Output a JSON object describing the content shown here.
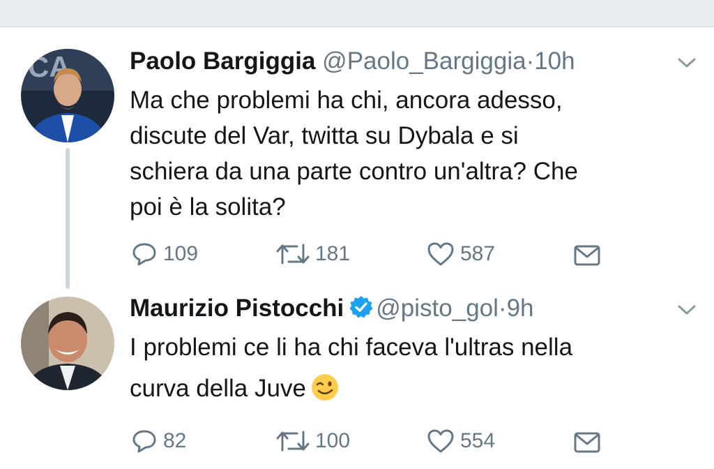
{
  "tweets": [
    {
      "name": "Paolo Bargiggia",
      "handle": "@Paolo_Bargiggia",
      "separator": "·",
      "time": "10h",
      "verified": false,
      "text_lines": [
        "Ma che problemi ha chi, ancora adesso,",
        "discute del Var, twitta su Dybala e si",
        "schiera da una parte contro un'altra? Che",
        "poi è la solita?"
      ],
      "replies": "109",
      "retweets": "181",
      "likes": "587"
    },
    {
      "name": "Maurizio Pistocchi",
      "handle": "@pisto_gol",
      "separator": "·",
      "time": "9h",
      "verified": true,
      "text_lines": [
        "I problemi ce li ha chi faceva l'ultras nella",
        "curva della Juve"
      ],
      "emoji": "winking-face",
      "replies": "82",
      "retweets": "100",
      "likes": "554"
    }
  ],
  "icons": {
    "reply": "reply-icon",
    "retweet": "retweet-icon",
    "like": "heart-icon",
    "message": "envelope-icon",
    "menu": "chevron-down-icon",
    "verified": "verified-badge-icon"
  },
  "colors": {
    "text": "#14171a",
    "secondary": "#657786",
    "verified": "#1da1f2",
    "thread_line": "#ccd6dd"
  }
}
